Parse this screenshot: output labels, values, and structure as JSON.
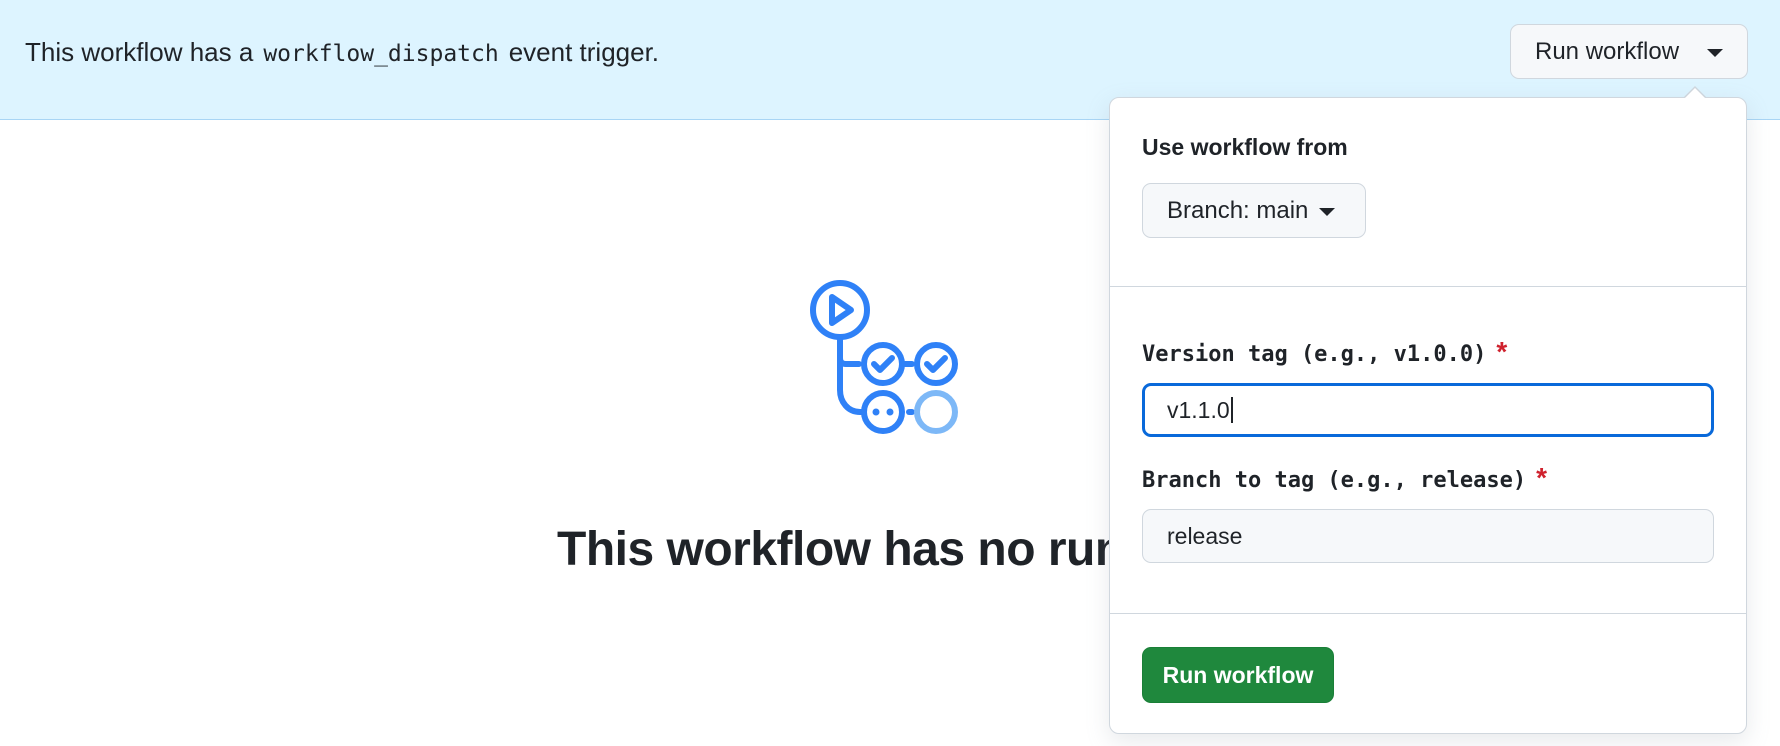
{
  "banner": {
    "text_before": "This workflow has a",
    "code": "workflow_dispatch",
    "text_after": "event trigger.",
    "run_button_label": "Run workflow"
  },
  "empty_state": {
    "icon": "workflow-graph-icon",
    "title": "This workflow has no runs"
  },
  "popover": {
    "heading": "Use workflow from",
    "branch_button_label": "Branch: main",
    "fields": [
      {
        "label": "Version tag (e.g., v1.0.0)",
        "required_mark": "*",
        "value": "v1.1.0"
      },
      {
        "label": "Branch to tag (e.g., release)",
        "required_mark": "*",
        "value": "release"
      }
    ],
    "submit_label": "Run workflow"
  },
  "colors": {
    "banner_bg": "#ddf4ff",
    "accent_blue": "#2f81f7",
    "primary_green": "#1f883d",
    "required_red": "#cf222e"
  }
}
